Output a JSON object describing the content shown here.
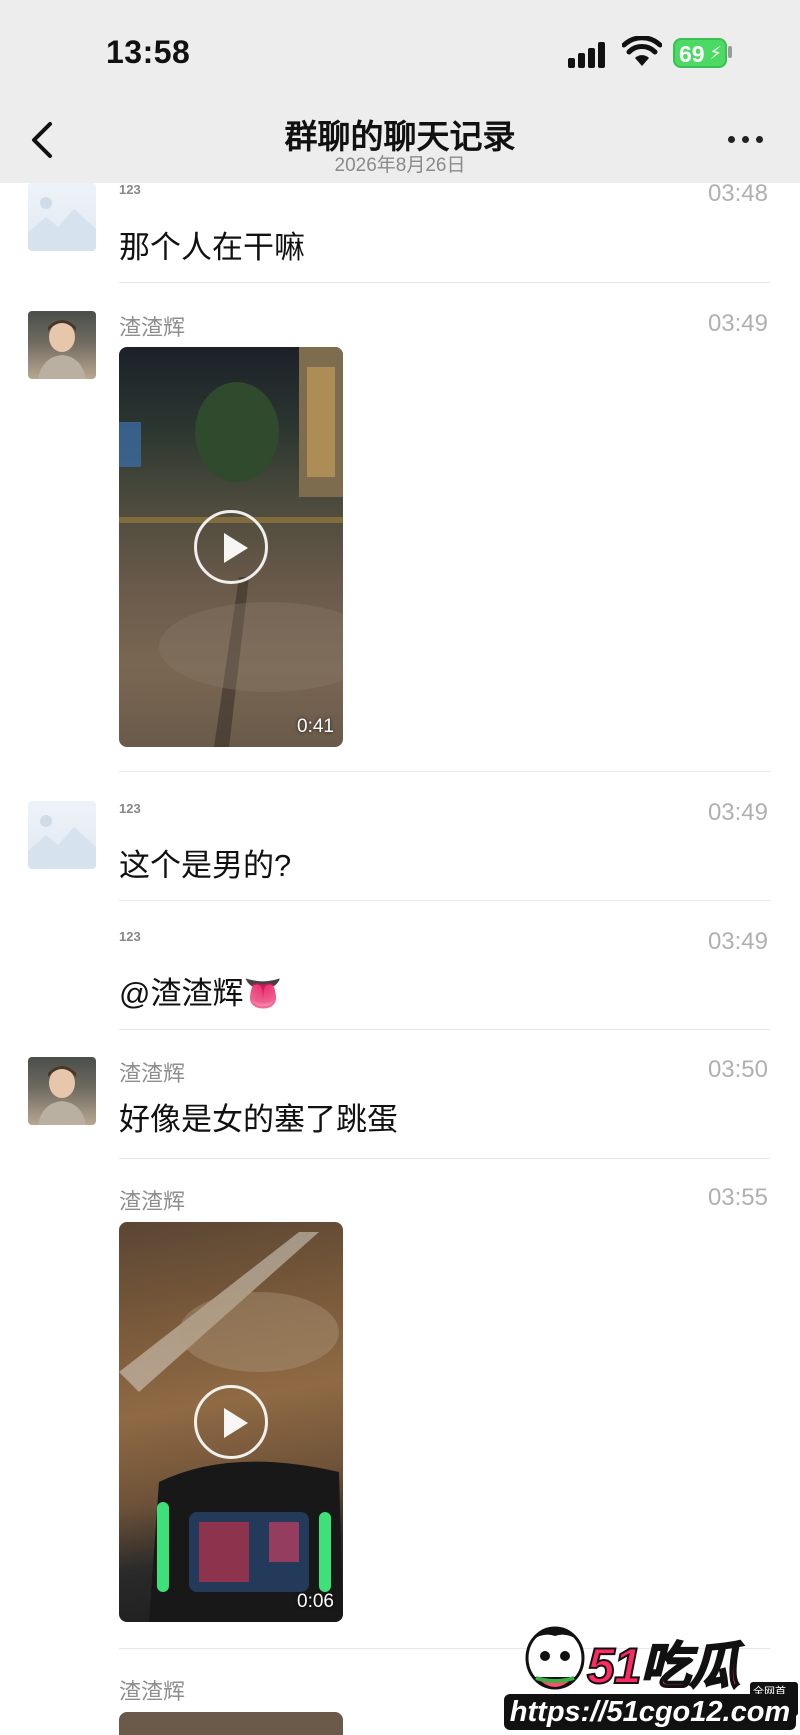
{
  "status_bar": {
    "time": "13:58",
    "battery": "69",
    "icons": [
      "signal-icon",
      "wifi-icon",
      "battery-charging-icon"
    ]
  },
  "nav": {
    "title": "群聊的聊天记录",
    "subtitle": "2026年8月26日",
    "back_icon": "chevron-left-icon",
    "more_icon": "more-dots-icon"
  },
  "messages": [
    {
      "sender": "123",
      "time": "03:48",
      "text": "那个人在干嘛"
    },
    {
      "sender": "渣渣辉",
      "time": "03:49",
      "video_duration": "0:41"
    },
    {
      "sender": "123",
      "time": "03:49",
      "text": "这个是男的?"
    },
    {
      "sender": "123",
      "time": "03:49",
      "text": "@渣渣辉👅"
    },
    {
      "sender": "渣渣辉",
      "time": "03:50",
      "text": "好像是女的塞了跳蛋"
    },
    {
      "sender": "渣渣辉",
      "time": "03:55",
      "video_duration": "0:06"
    },
    {
      "sender": "渣渣辉"
    }
  ],
  "watermark": {
    "brand": "51吃瓜",
    "badge": "全网首发",
    "url": "https://51cgo12.com"
  }
}
